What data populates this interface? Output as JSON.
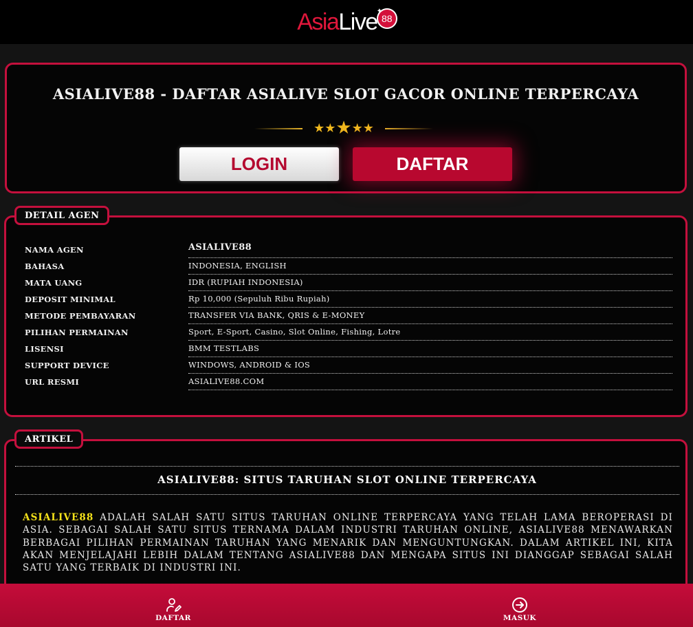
{
  "brand": {
    "logo_part1": "Asia",
    "logo_part2": "Live",
    "logo_number": "88"
  },
  "hero": {
    "title": "ASIALIVE88 - DAFTAR ASIALIVE SLOT GACOR ONLINE TERPERCAYA",
    "login_label": "LOGIN",
    "daftar_label": "DAFTAR"
  },
  "detail": {
    "tab_label": "DETAIL AGEN",
    "rows": [
      {
        "key": "NAMA AGEN",
        "value": "ASIALIVE88"
      },
      {
        "key": "BAHASA",
        "value": "INDONESIA, ENGLISH"
      },
      {
        "key": "MATA UANG",
        "value": "IDR (RUPIAH INDONESIA)"
      },
      {
        "key": "DEPOSIT MINIMAL",
        "value": "Rp 10,000 (Sepuluh Ribu Rupiah)"
      },
      {
        "key": "METODE PEMBAYARAN",
        "value": "TRANSFER VIA BANK, QRIS & E-MONEY"
      },
      {
        "key": "PILIHAN PERMAINAN",
        "value": "Sport, E-Sport, Casino, Slot Online, Fishing, Lotre"
      },
      {
        "key": "LISENSI",
        "value": "BMM TESTLABS"
      },
      {
        "key": "SUPPORT DEVICE",
        "value": "WINDOWS, ANDROID & IOS"
      },
      {
        "key": "URL RESMI",
        "value": "ASIALIVE88.COM"
      }
    ]
  },
  "article": {
    "tab_label": "ARTIKEL",
    "title": "ASIALIVE88: SITUS TARUHAN SLOT ONLINE TERPERCAYA",
    "highlight": "ASIALIVE88",
    "body": " ADALAH SALAH SATU SITUS TARUHAN ONLINE TERPERCAYA YANG TELAH LAMA BEROPERASI DI ASIA. SEBAGAI SALAH SATU SITUS TERNAMA DALAM INDUSTRI TARUHAN ONLINE, ASIALIVE88 MENAWARKAN BERBAGAI PILIHAN PERMAINAN TARUHAN YANG MENARIK DAN MENGUNTUNGKAN. DALAM ARTIKEL INI, KITA AKAN MENJELAJAHI LEBIH DALAM TENTANG ASIALIVE88 DAN MENGAPA SITUS INI DIANGGAP SEBAGAI SALAH SATU YANG TERBAIK DI INDUSTRI INI."
  },
  "bottom_nav": {
    "daftar_label": "DAFTAR",
    "masuk_label": "MASUK",
    "daftar_icon": "user-edit-icon",
    "masuk_icon": "arrow-circle-right-icon"
  },
  "colors": {
    "accent": "#c4103d",
    "highlight": "#f5e21a",
    "star": "#f0b81e"
  }
}
